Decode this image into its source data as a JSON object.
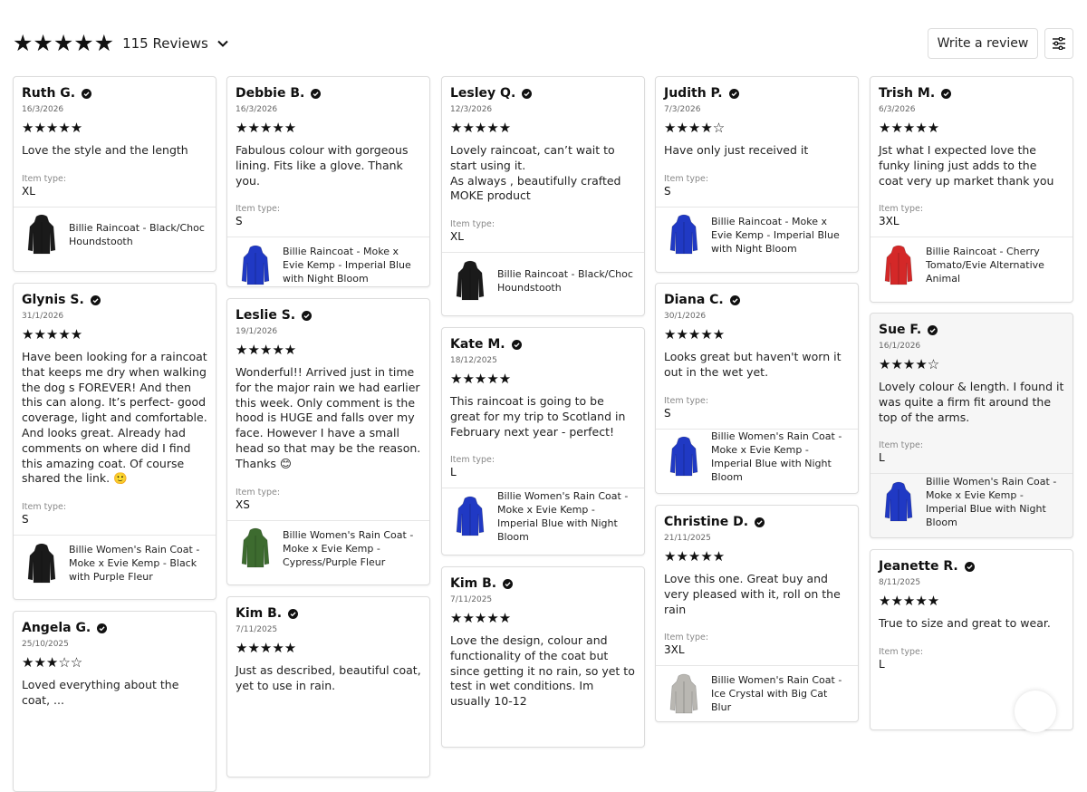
{
  "summary": {
    "stars": "★★★★★",
    "count_label": "115 Reviews"
  },
  "actions": {
    "write_review": "Write a review"
  },
  "item_type_label": "Item type:",
  "colors": {
    "black": "#1a1a1a",
    "blue": "#2039c4",
    "red": "#d42828",
    "green": "#3d6b2f",
    "grey": "#b9b7b2"
  },
  "columns": [
    [
      {
        "name": "Ruth G.",
        "date": "16/3/2026",
        "stars": "★★★★★",
        "text": "Love the style and the length",
        "item_type": "XL",
        "product": "Billie Raincoat - Black/Choc Houndstooth",
        "thumb": "black-coat-icon"
      },
      {
        "name": "Glynis S.",
        "date": "31/1/2026",
        "stars": "★★★★★",
        "text": "Have been looking for a raincoat that keeps me dry when walking the dog s FOREVER! And then this can along. It’s perfect- good coverage, light and comfortable. And looks great. Already had comments on where did I find this amazing coat. Of course shared the link. 🙂",
        "item_type": "S",
        "product": "Billie Women's Rain Coat - Moke x Evie Kemp - Black with Purple Fleur",
        "thumb": "black-coat-icon"
      },
      {
        "name": "Angela G.",
        "date": "25/10/2025",
        "stars": "★★★☆☆",
        "text": "Loved everything about the coat, ...",
        "item_type": "",
        "product": "",
        "thumb": ""
      }
    ],
    [
      {
        "name": "Debbie B.",
        "date": "16/3/2026",
        "stars": "★★★★★",
        "text": "Fabulous colour with gorgeous lining. Fits like a glove. Thank you.",
        "item_type": "S",
        "product": "Billie Raincoat - Moke x Evie Kemp - Imperial Blue with Night Bloom",
        "thumb": "blue-coat-icon"
      },
      {
        "name": "Leslie S.",
        "date": "19/1/2026",
        "stars": "★★★★★",
        "text": "Wonderful!! Arrived just in time for the major rain we had earlier this week.  Only comment is the hood is HUGE and falls over my face. However I have a small head so that may be the reason. Thanks 😊",
        "item_type": "XS",
        "product": "Billie Women's Rain Coat - Moke x Evie Kemp - Cypress/Purple Fleur",
        "thumb": "green-coat-icon"
      },
      {
        "name": "Kim B.",
        "date": "7/11/2025",
        "stars": "★★★★★",
        "text": "Just as described, beautiful coat, yet to use in rain.",
        "item_type": "",
        "product": "",
        "thumb": ""
      }
    ],
    [
      {
        "name": "Lesley Q.",
        "date": "12/3/2026",
        "stars": "★★★★★",
        "text": "Lovely raincoat, can’t wait to start using it.\nAs always , beautifully crafted MOKE product",
        "item_type": "XL",
        "product": "Billie Raincoat - Black/Choc Houndstooth",
        "thumb": "black-coat-icon"
      },
      {
        "name": "Kate M.",
        "date": "18/12/2025",
        "stars": "★★★★★",
        "text": "This raincoat is going to be great for my trip to Scotland in February next year - perfect!",
        "item_type": "L",
        "product": "Billie Women's Rain Coat - Moke x Evie Kemp - Imperial Blue with Night Bloom",
        "thumb": "blue-coat-icon"
      },
      {
        "name": "Kim B.",
        "date": "7/11/2025",
        "stars": "★★★★★",
        "text": "Love the design, colour and functionality of the coat but since getting it no rain, so yet to test in wet conditions. Im usually 10-12",
        "item_type": "",
        "product": "",
        "thumb": ""
      }
    ],
    [
      {
        "name": "Judith P.",
        "date": "7/3/2026",
        "stars": "★★★★☆",
        "text": "Have only just received it",
        "item_type": "S",
        "product": "Billie Raincoat - Moke x Evie Kemp - Imperial Blue with Night Bloom",
        "thumb": "blue-coat-icon"
      },
      {
        "name": "Diana C.",
        "date": "30/1/2026",
        "stars": "★★★★★",
        "text": "Looks great but haven't worn it out in the wet yet.",
        "item_type": "S",
        "product": "Billie Women's Rain Coat - Moke x Evie Kemp - Imperial Blue with Night Bloom",
        "thumb": "blue-coat-icon"
      },
      {
        "name": "Christine D.",
        "date": "21/11/2025",
        "stars": "★★★★★",
        "text": "Love this one. Great buy and very pleased with it, roll on the rain",
        "item_type": "3XL",
        "product": "Billie Women's Rain Coat - Ice Crystal with Big Cat Blur",
        "thumb": "grey-coat-icon"
      }
    ],
    [
      {
        "name": "Trish M.",
        "date": "6/3/2026",
        "stars": "★★★★★",
        "text": "Jst what I expected love the funky lining just adds to the coat very up market thank you",
        "item_type": "3XL",
        "product": "Billie Raincoat - Cherry Tomato/Evie Alternative Animal",
        "thumb": "red-coat-icon"
      },
      {
        "name": "Sue F.",
        "date": "16/1/2026",
        "stars": "★★★★☆",
        "text": "Lovely colour & length. I found it was  quite a firm fit around the top of the arms.",
        "item_type": "L",
        "product": "Billie Women's Rain Coat - Moke x Evie Kemp - Imperial Blue with Night Bloom",
        "thumb": "blue-coat-icon"
      },
      {
        "name": "Jeanette R.",
        "date": "8/11/2025",
        "stars": "★★★★★",
        "text": "True to size and great to wear.",
        "item_type": "L",
        "product": "",
        "thumb": ""
      }
    ]
  ]
}
